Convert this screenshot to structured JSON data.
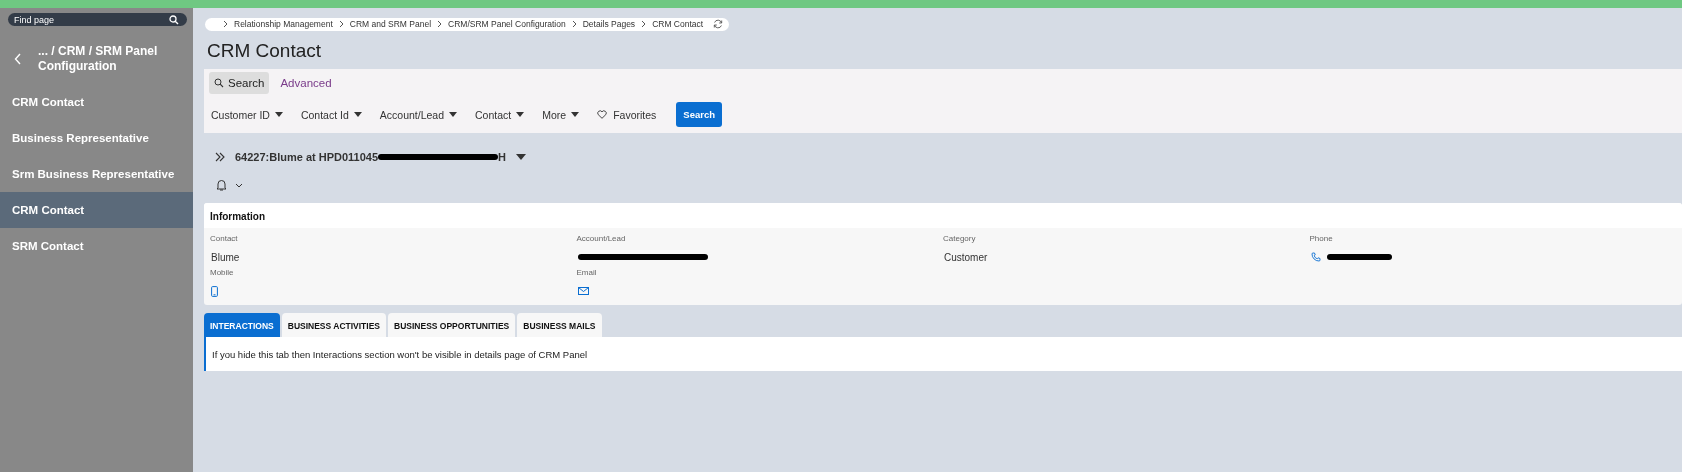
{
  "sidebar": {
    "search": {
      "placeholder": "Find page"
    },
    "back_title": "... / CRM / SRM Panel Configuration",
    "items": [
      {
        "label": "CRM Contact",
        "selected": false
      },
      {
        "label": "Business Representative",
        "selected": false
      },
      {
        "label": "Srm Business Representative",
        "selected": false
      },
      {
        "label": "CRM Contact",
        "selected": true
      },
      {
        "label": "SRM Contact",
        "selected": false
      }
    ]
  },
  "breadcrumb": [
    "Relationship Management",
    "CRM and SRM Panel",
    "CRM/SRM Panel Configuration",
    "Details Pages",
    "CRM Contact"
  ],
  "page_title": "CRM Contact",
  "search_modes": [
    {
      "label": "Search",
      "selected": true
    },
    {
      "label": "Advanced",
      "selected": false
    }
  ],
  "filters": [
    "Customer ID",
    "Contact Id",
    "Account/Lead",
    "Contact",
    "More"
  ],
  "favorites": "Favorites",
  "search_button": "Search",
  "record": {
    "title_start": "64227:Blume at HPD011045",
    "title_end": "H"
  },
  "information": {
    "title": "Information",
    "fields": [
      {
        "label": "Contact",
        "kind": "text",
        "value": "Blume"
      },
      {
        "label": "Account/Lead",
        "kind": "redacted"
      },
      {
        "label": "Category",
        "kind": "text",
        "value": "Customer"
      },
      {
        "label": "Phone",
        "kind": "phone"
      },
      {
        "label": "Mobile",
        "kind": "mobile"
      },
      {
        "label": "Email",
        "kind": "email"
      }
    ]
  },
  "tabs": [
    {
      "label": "INTERACTIONS",
      "selected": true
    },
    {
      "label": "BUSINESS ACTIVITIES",
      "selected": false
    },
    {
      "label": "BUSINESS OPPORTUNITIES",
      "selected": false
    },
    {
      "label": "BUSINESS MAILS",
      "selected": false
    }
  ],
  "tab_message": "If you hide this tab then Interactions section won't be visible in details page of CRM Panel"
}
